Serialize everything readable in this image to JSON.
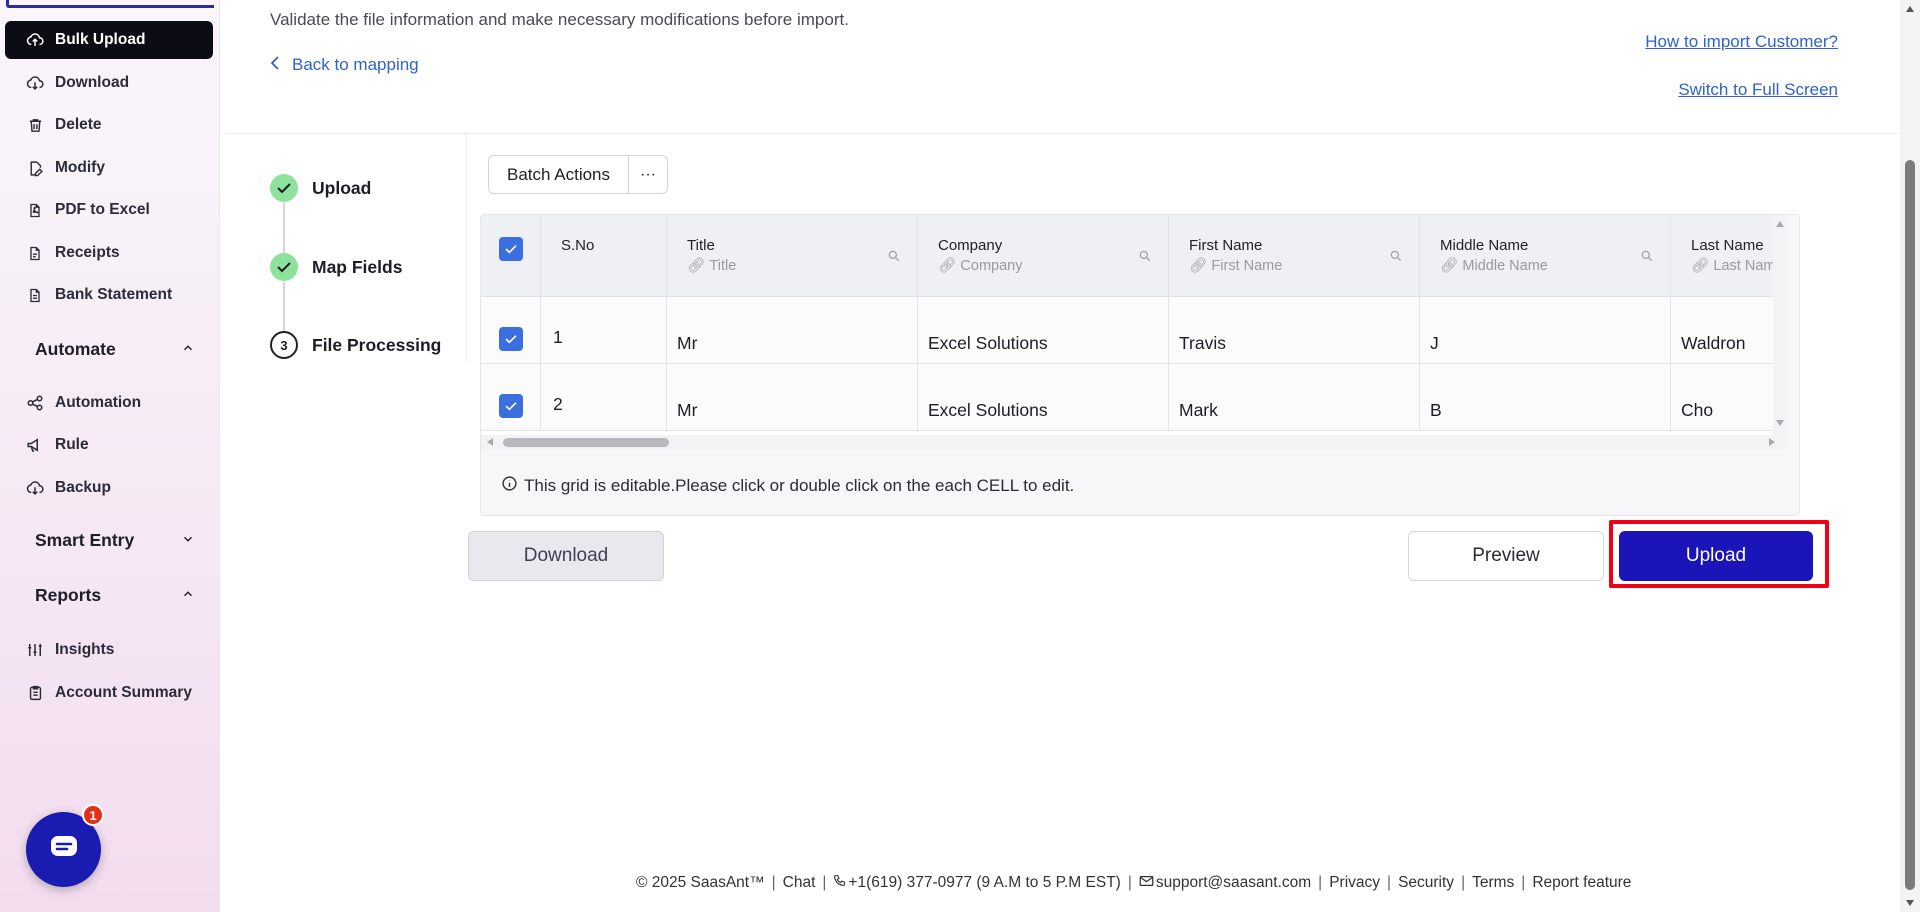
{
  "sidebar": {
    "items": [
      {
        "label": "Bulk Upload",
        "icon": "cloud-upload-icon"
      },
      {
        "label": "Download",
        "icon": "cloud-download-icon"
      },
      {
        "label": "Delete",
        "icon": "trash-icon"
      },
      {
        "label": "Modify",
        "icon": "edit-file-icon"
      },
      {
        "label": "PDF to Excel",
        "icon": "pdf-icon"
      },
      {
        "label": "Receipts",
        "icon": "receipt-icon"
      },
      {
        "label": "Bank Statement",
        "icon": "statement-icon"
      }
    ],
    "sections": {
      "automate": "Automate",
      "smart_entry": "Smart Entry",
      "reports": "Reports"
    },
    "automate_items": [
      {
        "label": "Automation",
        "icon": "share-nodes-icon"
      },
      {
        "label": "Rule",
        "icon": "megaphone-icon"
      },
      {
        "label": "Backup",
        "icon": "cloud-backup-icon"
      }
    ],
    "report_items": [
      {
        "label": "Insights",
        "icon": "sliders-icon"
      },
      {
        "label": "Account Summary",
        "icon": "clipboard-icon"
      }
    ],
    "chat_badge": "1"
  },
  "header": {
    "subtitle": "Validate the file information and make necessary modifications before import.",
    "back_link": "Back to mapping",
    "help_link": "How to import Customer?",
    "fullscreen_link": "Switch to Full Screen"
  },
  "stepper": [
    {
      "label": "Upload",
      "state": "done"
    },
    {
      "label": "Map Fields",
      "state": "done"
    },
    {
      "label": "File Processing",
      "state": "current",
      "number": "3"
    }
  ],
  "batch": {
    "label": "Batch Actions",
    "more": "···"
  },
  "grid": {
    "columns": [
      {
        "title": "S.No",
        "sub": ""
      },
      {
        "title": "Title",
        "sub": "Title"
      },
      {
        "title": "Company",
        "sub": "Company"
      },
      {
        "title": "First Name",
        "sub": "First Name"
      },
      {
        "title": "Middle Name",
        "sub": "Middle Name"
      },
      {
        "title": "Last Name",
        "sub": "Last Name"
      }
    ],
    "rows": [
      {
        "sno": "1",
        "title": "Mr",
        "company": "Excel Solutions",
        "first": "Travis",
        "middle": "J",
        "last": "Waldron"
      },
      {
        "sno": "2",
        "title": "Mr",
        "company": "Excel Solutions",
        "first": "Mark",
        "middle": "B",
        "last": "Cho"
      }
    ],
    "note": "This grid is editable.Please click or double click on the each CELL to edit."
  },
  "actions": {
    "download": "Download",
    "preview": "Preview",
    "upload": "Upload"
  },
  "footer": {
    "copyright": "© 2025 SaasAnt™",
    "chat": "Chat",
    "phone": "+1(619) 377-0977 (9 A.M to 5 P.M EST)",
    "email": "support@saasant.com",
    "privacy": "Privacy",
    "security": "Security",
    "terms": "Terms",
    "report": "Report feature"
  }
}
